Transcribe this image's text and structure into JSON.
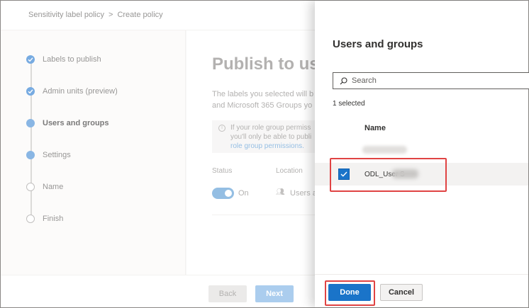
{
  "breadcrumb": {
    "parent": "Sensitivity label policy",
    "separator": ">",
    "current": "Create policy"
  },
  "steps": [
    {
      "label": "Labels to publish",
      "state": "done"
    },
    {
      "label": "Admin units (preview)",
      "state": "done"
    },
    {
      "label": "Users and groups",
      "state": "current"
    },
    {
      "label": "Settings",
      "state": "current"
    },
    {
      "label": "Name",
      "state": "todo"
    },
    {
      "label": "Finish",
      "state": "todo"
    }
  ],
  "main": {
    "title": "Publish to use",
    "desc_line1": "The labels you selected will b",
    "desc_line2": "and Microsoft 365 Groups yo",
    "info_line1": "If your role group permiss",
    "info_line2": "you'll only be able to publi",
    "info_link": "role group permissions.",
    "col_status": "Status",
    "col_location": "Location",
    "status_value": "On",
    "location_value": "Users ar"
  },
  "footer": {
    "back_label": "Back",
    "next_label": "Next"
  },
  "panel": {
    "title": "Users and groups",
    "search_placeholder": "Search",
    "selected_count": "1 selected",
    "col_name": "Name",
    "selected_user": "ODL_User S"
  },
  "panel_footer": {
    "done_label": "Done",
    "cancel_label": "Cancel"
  },
  "colors": {
    "accent": "#1a74c9",
    "highlight": "#e04343"
  }
}
